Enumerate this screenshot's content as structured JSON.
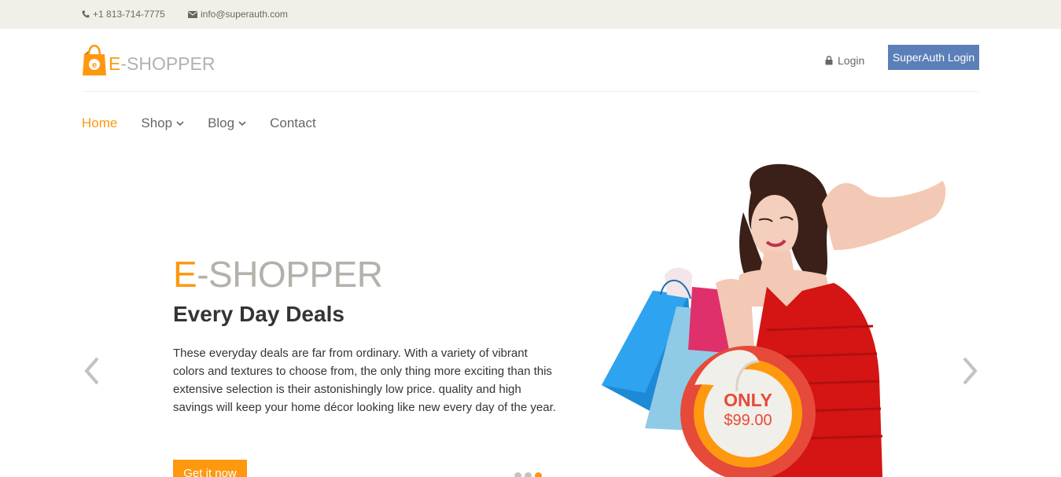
{
  "topbar": {
    "phone": "+1 813-714-7775",
    "email": "info@superauth.com",
    "phone_icon": "phone-icon",
    "email_icon": "envelope-icon"
  },
  "header": {
    "logo_prefix": "E",
    "logo_rest": "-SHOPPER",
    "login_label": "Login",
    "superauth_label": "SuperAuth Login"
  },
  "nav": {
    "items": [
      {
        "label": "Home",
        "active": true
      },
      {
        "label": "Shop",
        "has_dropdown": true
      },
      {
        "label": "Blog",
        "has_dropdown": true
      },
      {
        "label": "Contact"
      }
    ]
  },
  "slide": {
    "brand_prefix": "E",
    "brand_rest": "-SHOPPER",
    "title": "Every Day Deals",
    "text": "These everyday deals are far from ordinary. With a variety of vibrant colors and textures to choose from, the only thing more exciting than this extensive selection is their astonishingly low price. quality and high savings will keep your home décor looking like new every day of the year.",
    "cta_label": "Get it now",
    "badge_only": "ONLY",
    "badge_price": "$99.00",
    "slide_count": 3,
    "active_slide": 3
  },
  "colors": {
    "accent": "#fe980f",
    "topbar_bg": "#f0f0e9",
    "superauth_bg": "#5b7fb8",
    "badge_red": "#e64a3a"
  }
}
